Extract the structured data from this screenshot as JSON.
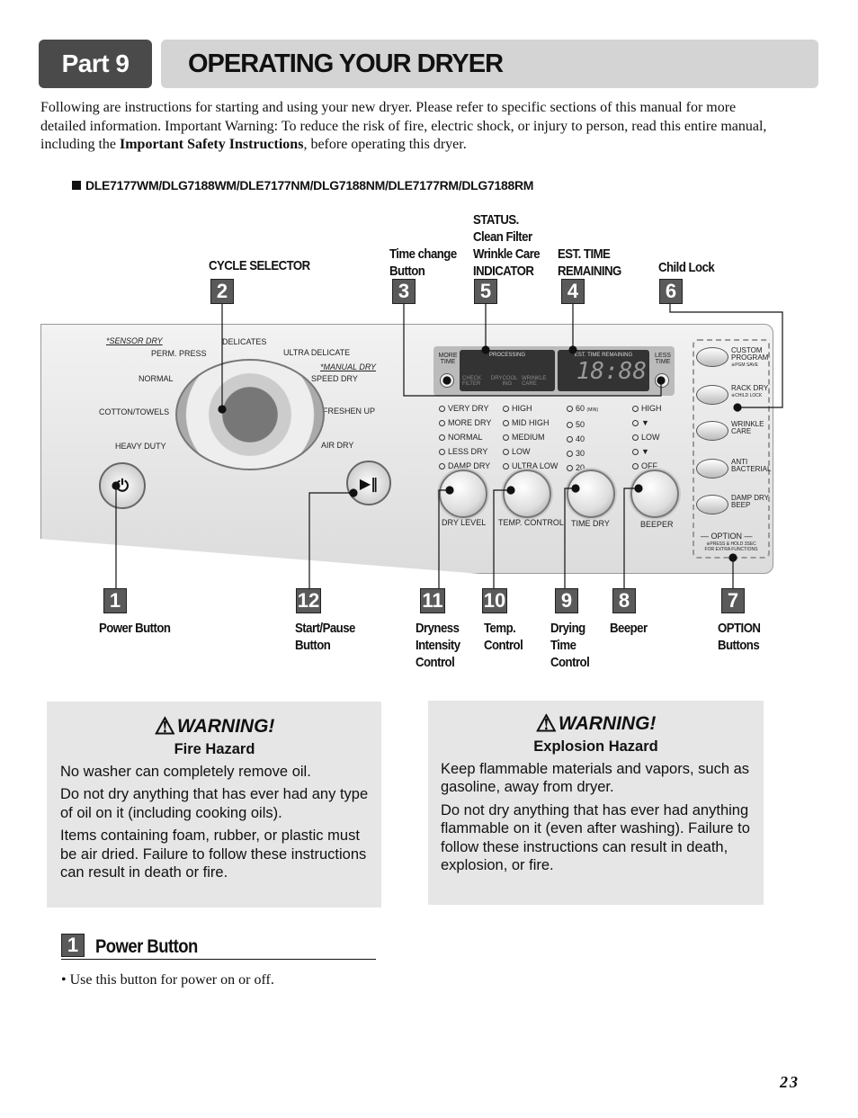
{
  "header": {
    "part": "Part 9",
    "title": "OPERATING YOUR DRYER"
  },
  "intro": {
    "text1": "Following are instructions for starting and using your new dryer.  Please refer to specific sections of this manual for more detailed information.  Important Warning:  To reduce the risk of fire, electric shock, or injury to person, read this entire manual, including the ",
    "bold": "Important Safety Instructions",
    "text2": ", before operating this dryer."
  },
  "models": "DLE7177WM/DLG7188WM/DLE7177NM/DLG7188NM/DLE7177RM/DLG7188RM",
  "callouts_top": [
    {
      "num": "2",
      "label": "CYCLE SELECTOR"
    },
    {
      "num": "3",
      "label": "Time change\nButton"
    },
    {
      "num": "5",
      "label": "STATUS.\nClean Filter\nWrinkle Care\nINDICATOR"
    },
    {
      "num": "4",
      "label": "EST. TIME\nREMAINING"
    },
    {
      "num": "6",
      "label": "Child Lock"
    }
  ],
  "callouts_bottom": [
    {
      "num": "1",
      "label": "Power Button"
    },
    {
      "num": "12",
      "label": "Start/Pause\nButton"
    },
    {
      "num": "11",
      "label": "Dryness\nIntensity\nControl"
    },
    {
      "num": "10",
      "label": "Temp.\nControl"
    },
    {
      "num": "9",
      "label": "Drying\nTime\nControl"
    },
    {
      "num": "8",
      "label": "Beeper"
    },
    {
      "num": "7",
      "label": "OPTION\nButtons"
    }
  ],
  "panel": {
    "cycles": [
      "*SENSOR DRY",
      "PERM. PRESS",
      "DELICATES",
      "ULTRA DELICATE",
      "*MANUAL DRY",
      "SPEED DRY",
      "NORMAL",
      "COTTON/TOWELS",
      "FRESHEN UP",
      "HEAVY DUTY",
      "AIR DRY"
    ],
    "more_time": "MORE TIME",
    "less_time": "LESS TIME",
    "processing": "PROCESSING",
    "status_items": [
      "CHECK FILTER",
      "DRY",
      "COOL ING",
      "WRINKLE CARE"
    ],
    "est_time": "EST. TIME REMAINING",
    "display": "18:88",
    "dry_level": {
      "label": "DRY LEVEL",
      "options": [
        "VERY DRY",
        "MORE DRY",
        "NORMAL",
        "LESS DRY",
        "DAMP DRY"
      ]
    },
    "temp": {
      "label": "TEMP. CONTROL",
      "options": [
        "HIGH",
        "MID HIGH",
        "MEDIUM",
        "LOW",
        "ULTRA LOW"
      ]
    },
    "time_dry": {
      "label": "TIME DRY",
      "options": [
        "60",
        "50",
        "40",
        "30",
        "20"
      ],
      "unit": "(MIN)"
    },
    "beeper": {
      "label": "BEEPER",
      "options": [
        "HIGH",
        "▼",
        "LOW",
        "▼",
        "OFF"
      ]
    },
    "options": [
      {
        "label": "CUSTOM PROGRAM",
        "sub": "※PGM SAVE"
      },
      {
        "label": "RACK DRY",
        "sub": "※CHILD LOCK"
      },
      {
        "label": "WRINKLE CARE",
        "sub": ""
      },
      {
        "label": "ANTI BACTERIAL",
        "sub": ""
      },
      {
        "label": "DAMP DRY BEEP",
        "sub": ""
      }
    ],
    "option_title": "— OPTION —",
    "option_note": "※PRESS & HOLD 3SEC FOR EXTRA FUNCTIONS"
  },
  "warnings": [
    {
      "title": "WARNING!",
      "hazard": "Fire Hazard",
      "paras": [
        "No washer can completely remove oil.",
        "Do not dry anything that has ever had any type of oil on it (including cooking oils).",
        "Items containing foam, rubber, or plastic  must be air dried. Failure to follow these instructions can result in death or fire."
      ]
    },
    {
      "title": "WARNING!",
      "hazard": "Explosion Hazard",
      "paras": [
        "Keep flammable materials and vapors, such as gasoline, away from dryer.",
        "Do not dry anything that has ever had anything flammable on it (even after washing). Failure to follow these instructions can result in death, explosion, or fire."
      ]
    }
  ],
  "section": {
    "num": "1",
    "title": "Power Button",
    "bullet": "• Use this button for power on or off."
  },
  "page_number": "23"
}
